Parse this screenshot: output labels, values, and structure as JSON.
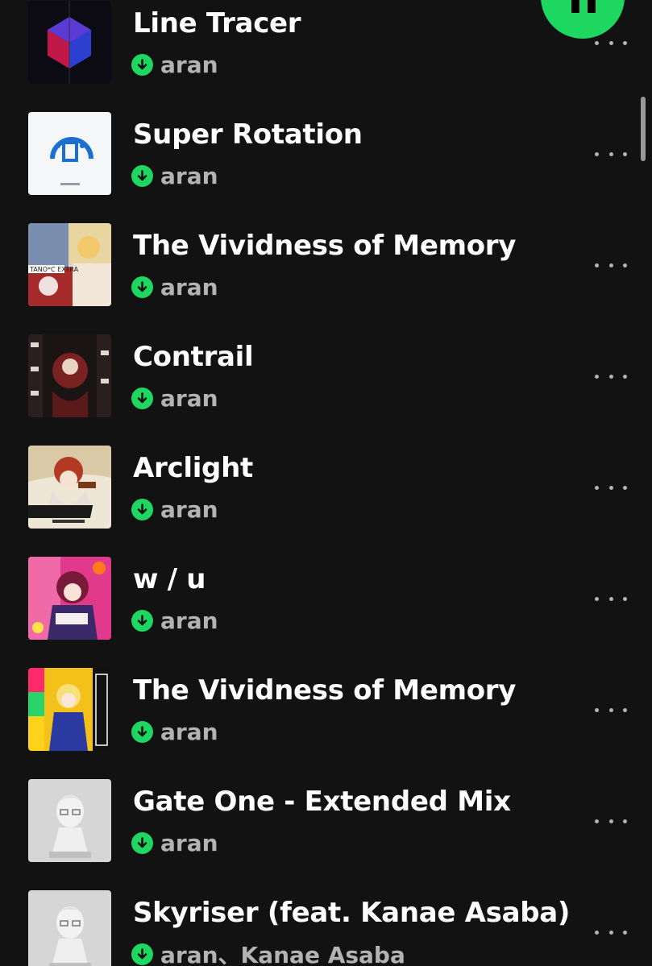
{
  "colors": {
    "background": "#121212",
    "accent": "#1ed760",
    "title_text": "#ffffff",
    "secondary_text": "#b3b3b3"
  },
  "player": {
    "fab_icon": "pause-icon"
  },
  "tracks": [
    {
      "title": "Line Tracer",
      "artist": "aran",
      "downloaded": true,
      "cover": "line-tracer-cover"
    },
    {
      "title": "Super Rotation",
      "artist": "aran",
      "downloaded": true,
      "cover": "super-rotation-cover"
    },
    {
      "title": "The Vividness of Memory",
      "artist": "aran",
      "downloaded": true,
      "cover": "tano-c-extra-cover"
    },
    {
      "title": "Contrail",
      "artist": "aran",
      "downloaded": true,
      "cover": "contrail-cover"
    },
    {
      "title": "Arclight",
      "artist": "aran",
      "downloaded": true,
      "cover": "arclight-cover"
    },
    {
      "title": "w / u",
      "artist": "aran",
      "downloaded": true,
      "cover": "w-u-cover"
    },
    {
      "title": "The Vividness of Memory",
      "artist": "aran",
      "downloaded": true,
      "cover": "bright-colors-cover"
    },
    {
      "title": "Gate One - Extended Mix",
      "artist": "aran",
      "downloaded": true,
      "cover": "gate-one-cover"
    },
    {
      "title": "Skyriser (feat. Kanae Asaba)",
      "artist": "aran、Kanae Asaba",
      "downloaded": true,
      "cover": "skyriser-cover"
    }
  ]
}
